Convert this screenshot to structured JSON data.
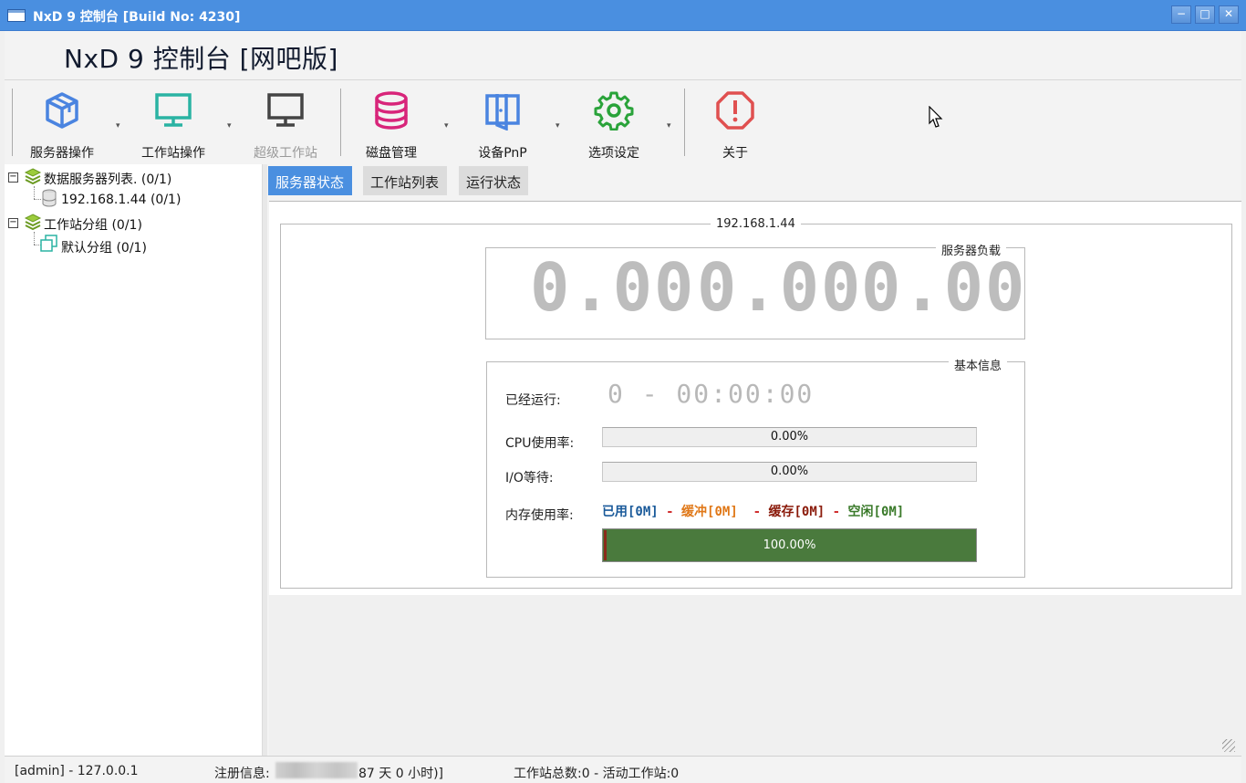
{
  "window": {
    "title": "NxD 9 控制台 [Build No: 4230]",
    "min_label": "−",
    "max_label": "□",
    "close_label": "✕"
  },
  "header": {
    "app_title": "NxD 9 控制台 [网吧版]"
  },
  "toolbar": {
    "items": [
      {
        "label": "服务器操作",
        "icon": "server-cube-icon",
        "color": "#4a84e0",
        "has_dropdown": true
      },
      {
        "label": "工作站操作",
        "icon": "monitor-icon",
        "color": "#2ab3a3",
        "has_dropdown": true
      },
      {
        "label": "超级工作站",
        "icon": "monitor-disabled-icon",
        "color": "#4a4a4a",
        "disabled": true
      },
      {
        "label": "磁盘管理",
        "icon": "database-icon",
        "color": "#d8257a",
        "has_dropdown": true
      },
      {
        "label": "设备PnP",
        "icon": "device-icon",
        "color": "#4a84e0",
        "has_dropdown": true
      },
      {
        "label": "选项设定",
        "icon": "gear-icon",
        "color": "#2aa33a",
        "has_dropdown": true
      },
      {
        "label": "关于",
        "icon": "alert-icon",
        "color": "#e05050"
      }
    ]
  },
  "tree": {
    "server_list_label": "数据服务器列表. (0/1)",
    "server_node": "192.168.1.44 (0/1)",
    "workstation_group_label": "工作站分组 (0/1)",
    "default_group": "默认分组 (0/1)"
  },
  "tabs": [
    "服务器状态",
    "工作站列表",
    "运行状态"
  ],
  "server_status": {
    "server_ip": "192.168.1.44",
    "load_title": "服务器负载",
    "loads": [
      "0.00",
      "0.00",
      "0.00"
    ],
    "basic_info_title": "基本信息",
    "uptime_label": "已经运行:",
    "uptime_value": "0 - 00:00:00",
    "cpu_label": "CPU使用率:",
    "cpu_value": "0.00%",
    "cpu_fraction": 0.0,
    "io_label": "I/O等待:",
    "io_value": "0.00%",
    "io_fraction": 0.0,
    "mem_label": "内存使用率:",
    "mem_used": "已用[0M]",
    "mem_buffer": "缓冲[0M]",
    "mem_cache": "缓存[0M]",
    "mem_free": "空闲[0M]",
    "mem_sep": "-",
    "mem_value": "100.00%",
    "colors": {
      "used": "#1a5a9a",
      "buffer": "#e07818",
      "cache": "#8a1a0a",
      "free": "#3a7a2a",
      "sep": "#d03030"
    }
  },
  "statusbar": {
    "user": "[admin] - 127.0.0.1",
    "reg_label": "注册信息:",
    "reg_suffix": "87 天 0 小时)]",
    "workstations": "工作站总数:0 - 活动工作站:0"
  }
}
